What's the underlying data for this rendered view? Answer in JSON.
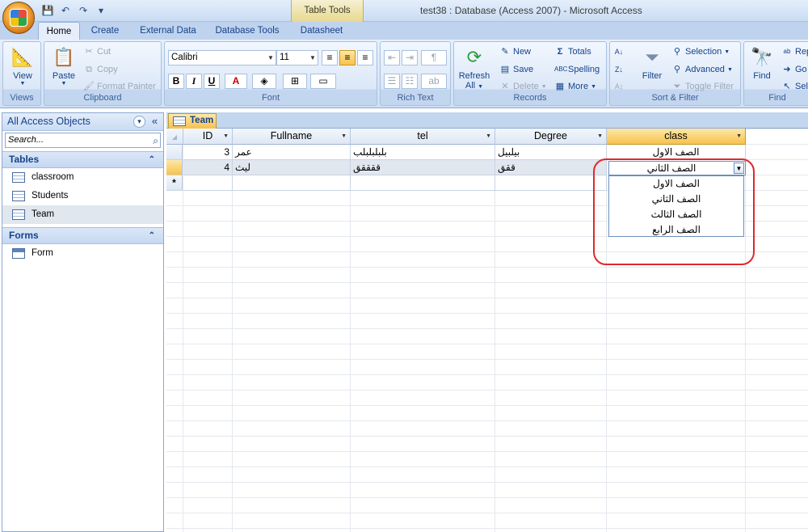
{
  "window": {
    "title": "test38 : Database (Access 2007) - Microsoft Access",
    "context_tab": "Table Tools"
  },
  "ribbon_tabs": [
    "Home",
    "Create",
    "External Data",
    "Database Tools",
    "Datasheet"
  ],
  "ribbon": {
    "views": {
      "view_label": "View",
      "group_label": "Views"
    },
    "clipboard": {
      "paste_label": "Paste",
      "cut_label": "Cut",
      "copy_label": "Copy",
      "format_painter_label": "Format Painter",
      "group_label": "Clipboard"
    },
    "font": {
      "font_name": "Calibri",
      "font_size": "11",
      "bold": "B",
      "italic": "I",
      "underline": "U",
      "group_label": "Font"
    },
    "rich_text": {
      "group_label": "Rich Text"
    },
    "records": {
      "refresh_label_1": "Refresh",
      "refresh_label_2": "All",
      "new_label": "New",
      "save_label": "Save",
      "delete_label": "Delete",
      "totals_label": "Totals",
      "spelling_label": "Spelling",
      "more_label": "More",
      "group_label": "Records"
    },
    "sort_filter": {
      "filter_label": "Filter",
      "selection_label": "Selection",
      "advanced_label": "Advanced",
      "toggle_filter_label": "Toggle Filter",
      "group_label": "Sort & Filter"
    },
    "find": {
      "find_label": "Find",
      "replace_label": "Rep",
      "goto_label": "Go",
      "select_label": "Sel",
      "group_label": "Find"
    }
  },
  "nav_pane": {
    "title": "All Access Objects",
    "search_placeholder": "Search...",
    "groups": [
      {
        "label": "Tables",
        "items": [
          "classroom",
          "Students",
          "Team"
        ]
      },
      {
        "label": "Forms",
        "items": [
          "Form"
        ]
      }
    ]
  },
  "document_tab": "Team",
  "table": {
    "columns": [
      "ID",
      "Fullname",
      "tel",
      "Degree",
      "class"
    ],
    "rows": [
      {
        "ID": "3",
        "Fullname": "عمر",
        "tel": "بلبلبلبلب",
        "Degree": "بيلبيل",
        "class": "الصف الاول"
      },
      {
        "ID": "4",
        "Fullname": "ليث",
        "tel": "ققققق",
        "Degree": "ققق",
        "class": "الصف الثاني"
      }
    ],
    "new_row_marker": "*"
  },
  "class_dropdown": {
    "current_value": "الصف الثاني",
    "options": [
      "الصف الاول",
      "الصف الثاني",
      "الصف الثالث",
      "الصف الرابع"
    ]
  },
  "colors": {
    "annotation": "#e0282c",
    "ribbon_accent": "#15428b",
    "active_header": "#f7c24c"
  }
}
